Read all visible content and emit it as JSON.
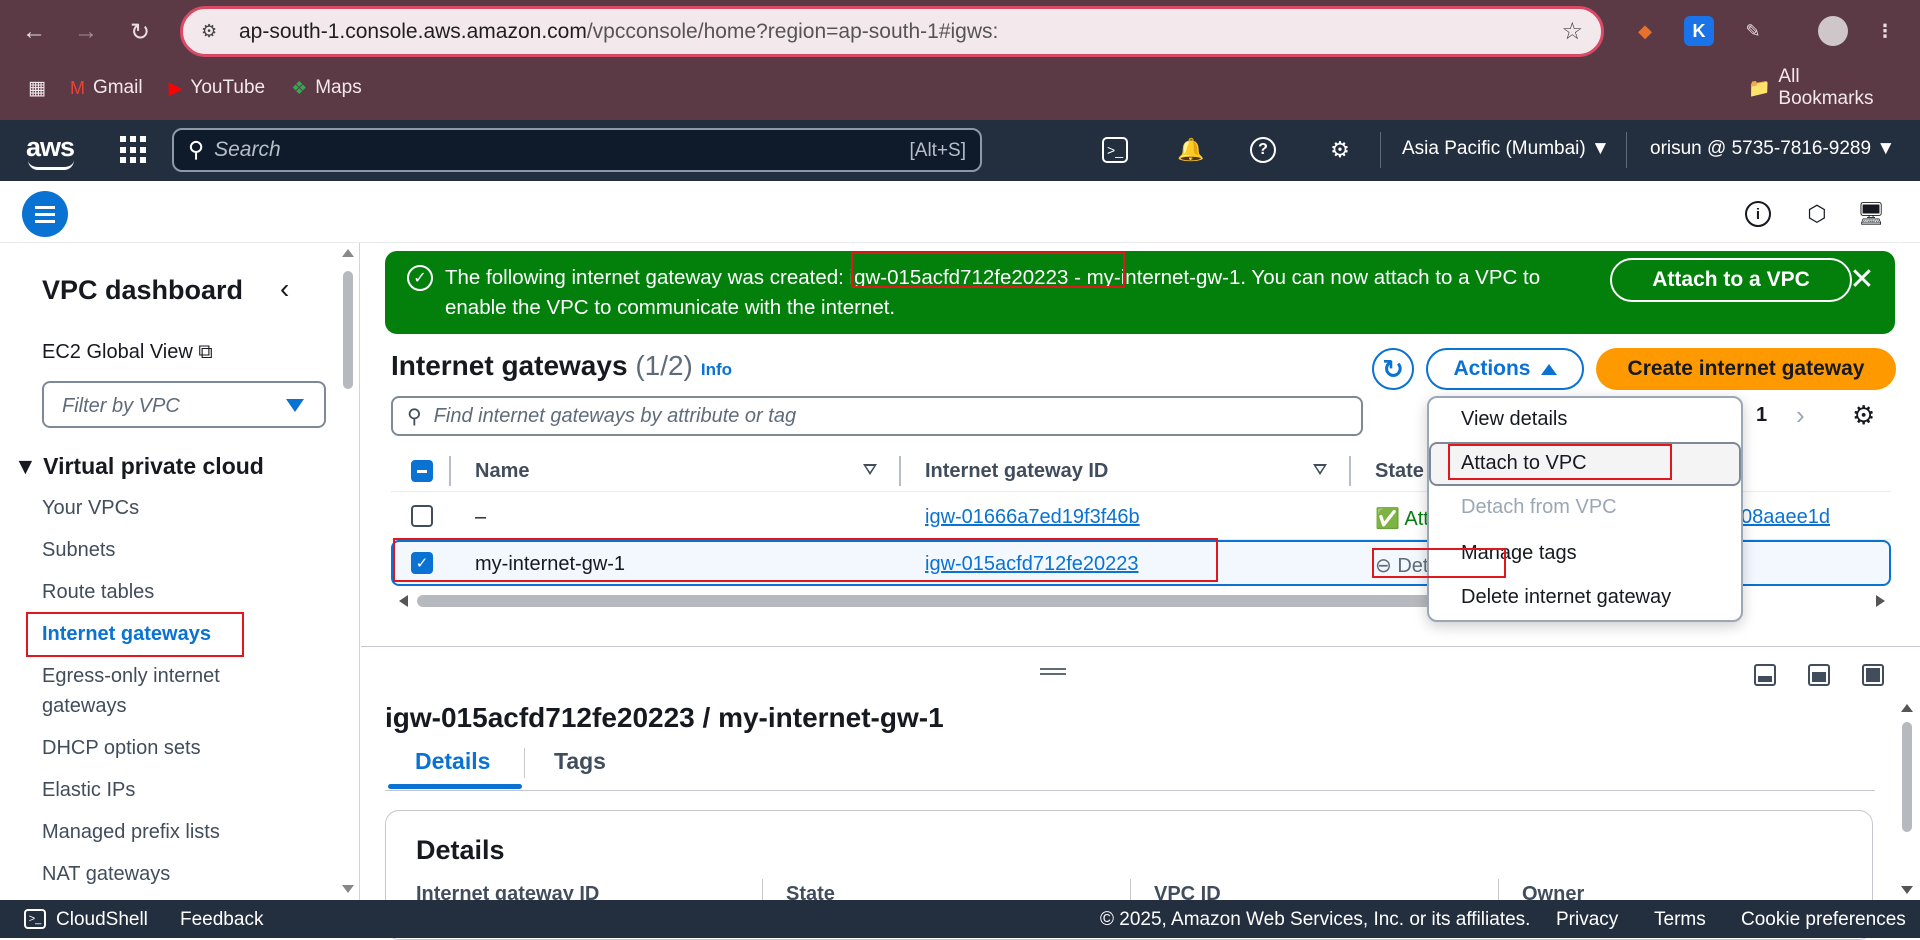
{
  "browser": {
    "url_host": "ap-south-1.console.aws.amazon.com",
    "url_path": "/vpcconsole/home?region=ap-south-1#igws:",
    "bookmarks": [
      "Gmail",
      "YouTube",
      "Maps"
    ],
    "all_bookmarks": "All Bookmarks"
  },
  "header": {
    "logo": "aws",
    "search_placeholder": "Search",
    "search_shortcut": "[Alt+S]",
    "region": "Asia Pacific (Mumbai)",
    "account": "orisun @ 5735-7816-9289"
  },
  "sidebar": {
    "title": "VPC dashboard",
    "ec2_global_view": "EC2 Global View",
    "filter_placeholder": "Filter by VPC",
    "section": "Virtual private cloud",
    "items": [
      {
        "label": "Your VPCs"
      },
      {
        "label": "Subnets"
      },
      {
        "label": "Route tables"
      },
      {
        "label": "Internet gateways"
      },
      {
        "label": "Egress-only internet gateways"
      },
      {
        "label": "DHCP option sets"
      },
      {
        "label": "Elastic IPs"
      },
      {
        "label": "Managed prefix lists"
      },
      {
        "label": "NAT gateways"
      }
    ]
  },
  "flash": {
    "message": "The following internet gateway was created: igw-015acfd712fe20223 - my-internet-gw-1. You can now attach to a VPC to enable the VPC to communicate with the internet.",
    "action": "Attach to a VPC",
    "color": "#037f0c"
  },
  "table": {
    "title": "Internet gateways",
    "count": "(1/2)",
    "info": "Info",
    "actions_label": "Actions",
    "create_label": "Create internet gateway",
    "search_placeholder": "Find internet gateways by attribute or tag",
    "page": "1",
    "columns": [
      "Name",
      "Internet gateway ID",
      "State"
    ],
    "rows": [
      {
        "name": "–",
        "id": "igw-01666a7ed19f3f46b",
        "state": "Attached",
        "vpc_tail": "08aaee1d",
        "selected": false
      },
      {
        "name": "my-internet-gw-1",
        "id": "igw-015acfd712fe20223",
        "state": "Detached",
        "selected": true
      }
    ]
  },
  "actions_menu": {
    "items": [
      {
        "label": "View details",
        "disabled": false
      },
      {
        "label": "Attach to VPC",
        "disabled": false
      },
      {
        "label": "Detach from VPC",
        "disabled": true
      },
      {
        "label": "Manage tags",
        "disabled": false
      },
      {
        "label": "Delete internet gateway",
        "disabled": false
      }
    ]
  },
  "detail": {
    "title": "igw-015acfd712fe20223 / my-internet-gw-1",
    "tabs": [
      "Details",
      "Tags"
    ],
    "section": "Details",
    "columns": [
      "Internet gateway ID",
      "State",
      "VPC ID",
      "Owner"
    ]
  },
  "footer": {
    "cloudshell": "CloudShell",
    "feedback": "Feedback",
    "copyright": "© 2025, Amazon Web Services, Inc. or its affiliates.",
    "links": [
      "Privacy",
      "Terms",
      "Cookie preferences"
    ]
  },
  "colors": {
    "accent": "#0972d3",
    "primary_button": "#ff9900",
    "header_bg": "#232f3e",
    "annotation": "#e0181e"
  }
}
